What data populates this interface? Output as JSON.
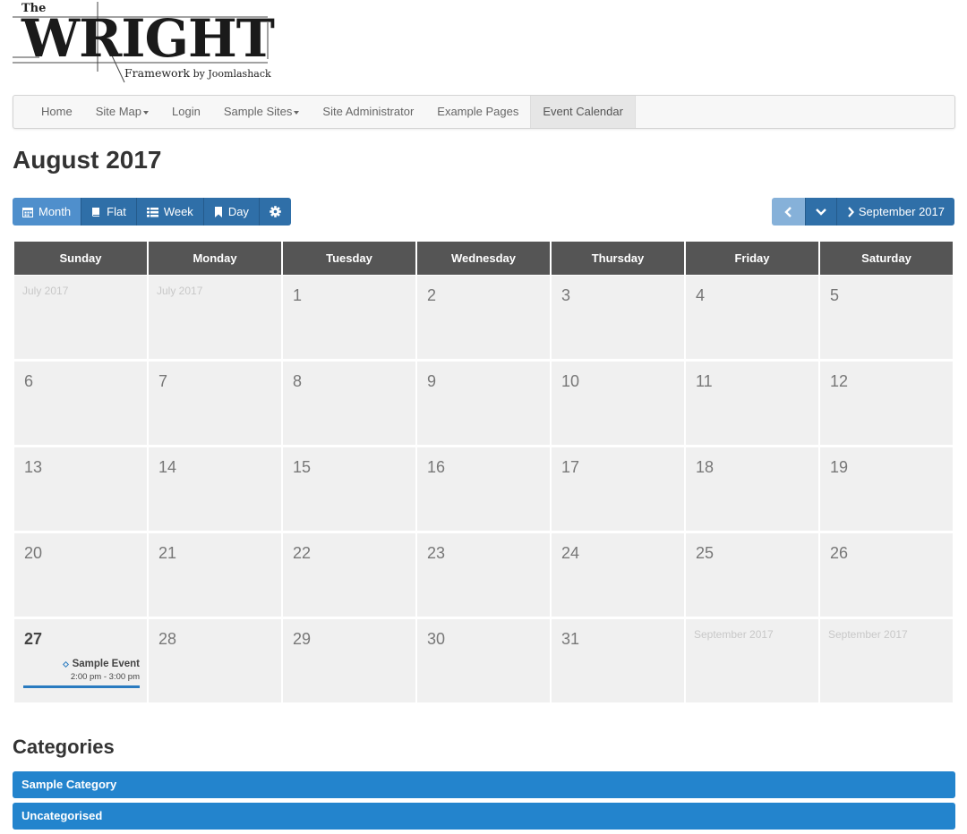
{
  "logo": {
    "prefix": "The",
    "wordmark": "WRIGHT",
    "byline_main": "Framework",
    "byline_by": " by Joomlashack"
  },
  "nav": {
    "items": [
      {
        "label": "Home",
        "dropdown": false,
        "active": false
      },
      {
        "label": "Site Map",
        "dropdown": true,
        "active": false
      },
      {
        "label": "Login",
        "dropdown": false,
        "active": false
      },
      {
        "label": "Sample Sites",
        "dropdown": true,
        "active": false
      },
      {
        "label": "Site Administrator",
        "dropdown": false,
        "active": false
      },
      {
        "label": "Example Pages",
        "dropdown": false,
        "active": false
      },
      {
        "label": "Event Calendar",
        "dropdown": false,
        "active": true
      }
    ]
  },
  "page": {
    "title": "August 2017"
  },
  "toolbar": {
    "views": [
      {
        "label": "Month",
        "icon": "calendar-icon",
        "active": true
      },
      {
        "label": "Flat",
        "icon": "book-icon",
        "active": false
      },
      {
        "label": "Week",
        "icon": "list-icon",
        "active": false
      },
      {
        "label": "Day",
        "icon": "bookmark-icon",
        "active": false
      }
    ],
    "settings_icon": "gear-icon",
    "prev_icon": "chevron-left-icon",
    "down_icon": "chevron-down-icon",
    "next_label": "September 2017",
    "next_icon": "chevron-right-icon"
  },
  "calendar": {
    "weekdays": [
      "Sunday",
      "Monday",
      "Tuesday",
      "Wednesday",
      "Thursday",
      "Friday",
      "Saturday"
    ],
    "weeks": [
      [
        {
          "other": "July 2017"
        },
        {
          "other": "July 2017"
        },
        {
          "num": "1"
        },
        {
          "num": "2"
        },
        {
          "num": "3"
        },
        {
          "num": "4"
        },
        {
          "num": "5"
        }
      ],
      [
        {
          "num": "6"
        },
        {
          "num": "7"
        },
        {
          "num": "8"
        },
        {
          "num": "9"
        },
        {
          "num": "10"
        },
        {
          "num": "11"
        },
        {
          "num": "12"
        }
      ],
      [
        {
          "num": "13"
        },
        {
          "num": "14"
        },
        {
          "num": "15"
        },
        {
          "num": "16"
        },
        {
          "num": "17"
        },
        {
          "num": "18"
        },
        {
          "num": "19"
        }
      ],
      [
        {
          "num": "20"
        },
        {
          "num": "21"
        },
        {
          "num": "22"
        },
        {
          "num": "23"
        },
        {
          "num": "24"
        },
        {
          "num": "25"
        },
        {
          "num": "26"
        }
      ],
      [
        {
          "num": "27",
          "today": true,
          "event": {
            "title": "Sample Event",
            "time": "2:00 pm - 3:00 pm"
          }
        },
        {
          "num": "28"
        },
        {
          "num": "29"
        },
        {
          "num": "30"
        },
        {
          "num": "31"
        },
        {
          "other": "September 2017"
        },
        {
          "other": "September 2017"
        }
      ]
    ]
  },
  "categories": {
    "title": "Categories",
    "items": [
      "Sample Category",
      "Uncategorised"
    ]
  },
  "colors": {
    "button": "#2f6fa8",
    "button_active": "#4f8fcc",
    "category": "#2384cd",
    "header_cell": "#555555",
    "day_cell": "#f0f0f0",
    "event_accent": "#2a7bc0"
  }
}
